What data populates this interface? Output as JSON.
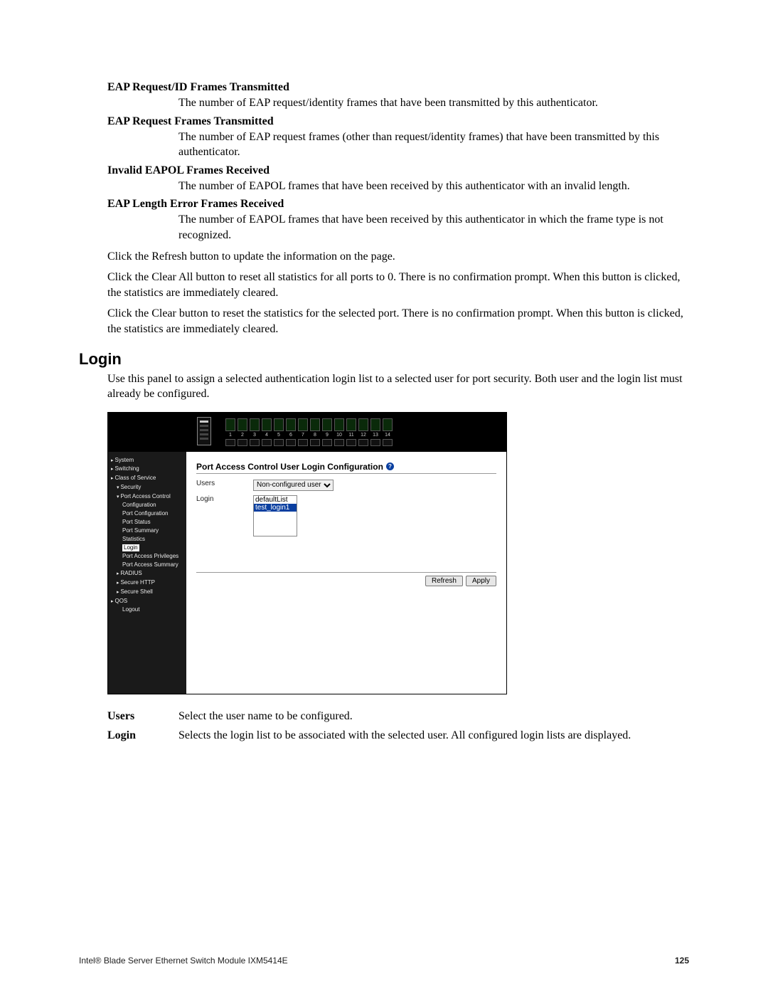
{
  "definitions": [
    {
      "term": "EAP Request/ID Frames Transmitted",
      "body": "The number of EAP request/identity frames that have been transmitted by this authenticator."
    },
    {
      "term": "EAP Request Frames Transmitted",
      "body": "The number of EAP request frames (other than request/identity frames) that have been transmitted by this authenticator."
    },
    {
      "term": "Invalid EAPOL Frames Received",
      "body": "The number of EAPOL frames that have been received by this authenticator with an invalid length."
    },
    {
      "term": "EAP Length Error Frames Received",
      "body": "The number of EAPOL frames that have been received by this authenticator in which the frame type is not recognized."
    }
  ],
  "paras": {
    "p1": "Click the Refresh button to update the information on the page.",
    "p2": "Click the Clear All button to reset all statistics for all ports to 0. There is no confirmation prompt. When this button is clicked, the statistics are immediately cleared.",
    "p3": "Click the Clear button to reset the statistics for the selected port. There is no confirmation prompt. When this button is clicked, the statistics are immediately cleared."
  },
  "login_heading": "Login",
  "login_intro": "Use this panel to assign a selected authentication login list to a selected user for port security. Both user and the login list must already be configured.",
  "screenshot": {
    "port_numbers": [
      "1",
      "2",
      "3",
      "4",
      "5",
      "6",
      "7",
      "8",
      "9",
      "10",
      "11",
      "12",
      "13",
      "14"
    ],
    "nav": {
      "items": [
        {
          "cls": "lvl1",
          "label": "System"
        },
        {
          "cls": "lvl1",
          "label": "Switching"
        },
        {
          "cls": "lvl1",
          "label": "Class of Service"
        },
        {
          "cls": "lvl2",
          "label": "Security"
        },
        {
          "cls": "lvl2",
          "label": "Port Access Control",
          "indent": "lvl2"
        },
        {
          "cls": "lvl3",
          "label": "Configuration"
        },
        {
          "cls": "lvl3",
          "label": "Port Configuration"
        },
        {
          "cls": "lvl3",
          "label": "Port Status"
        },
        {
          "cls": "lvl3",
          "label": "Port Summary"
        },
        {
          "cls": "lvl3",
          "label": "Statistics"
        },
        {
          "cls": "lvl3 sel",
          "label": "Login"
        },
        {
          "cls": "lvl3",
          "label": "Port Access Privileges"
        },
        {
          "cls": "lvl3",
          "label": "Port Access Summary"
        },
        {
          "cls": "lvl2c",
          "label": "RADIUS",
          "indent": "lvl2"
        },
        {
          "cls": "lvl2c",
          "label": "Secure HTTP",
          "indent": "lvl2"
        },
        {
          "cls": "lvl2c",
          "label": "Secure Shell",
          "indent": "lvl2"
        },
        {
          "cls": "lvl1",
          "label": "QOS"
        },
        {
          "cls": "lvl3",
          "label": "Logout"
        }
      ]
    },
    "panel_title": "Port Access Control User Login Configuration",
    "label_users": "Users",
    "label_login": "Login",
    "users_selected": "Non-configured user",
    "login_options": [
      "defaultList",
      "test_login1"
    ],
    "login_selected_index": 1,
    "btn_refresh": "Refresh",
    "btn_apply": "Apply"
  },
  "below": {
    "users_term": "Users",
    "users_body": "Select the user name to be configured.",
    "login_term": "Login",
    "login_body": "Selects the login list to be associated with the selected user. All configured login lists are displayed."
  },
  "footer": {
    "left": "Intel® Blade Server Ethernet Switch Module IXM5414E",
    "page": "125"
  }
}
